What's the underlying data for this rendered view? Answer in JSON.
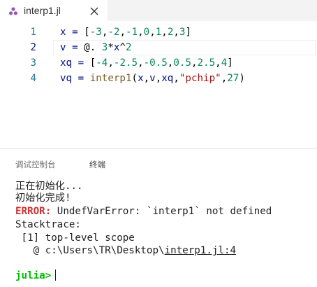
{
  "tab": {
    "label": "interp1.jl",
    "file_icon": "julia-file-icon",
    "close_icon": "close-icon",
    "icon_color": "#9558b2"
  },
  "editor": {
    "current_line": 2,
    "lines": [
      {
        "number": "1",
        "tokens": [
          {
            "t": "x = ",
            "c": "var"
          },
          {
            "t": "[",
            "c": "op"
          },
          {
            "t": "-3",
            "c": "num"
          },
          {
            "t": ",",
            "c": "op"
          },
          {
            "t": "-2",
            "c": "num"
          },
          {
            "t": ",",
            "c": "op"
          },
          {
            "t": "-1",
            "c": "num"
          },
          {
            "t": ",",
            "c": "op"
          },
          {
            "t": "0",
            "c": "num"
          },
          {
            "t": ",",
            "c": "op"
          },
          {
            "t": "1",
            "c": "num"
          },
          {
            "t": ",",
            "c": "op"
          },
          {
            "t": "2",
            "c": "num"
          },
          {
            "t": ",",
            "c": "op"
          },
          {
            "t": "3",
            "c": "num"
          },
          {
            "t": "]",
            "c": "op"
          }
        ]
      },
      {
        "number": "2",
        "tokens": [
          {
            "t": "v = ",
            "c": "var"
          },
          {
            "t": "@. ",
            "c": "op"
          },
          {
            "t": "3",
            "c": "num"
          },
          {
            "t": "*",
            "c": "op"
          },
          {
            "t": "x",
            "c": "var"
          },
          {
            "t": "^",
            "c": "op"
          },
          {
            "t": "2",
            "c": "num"
          }
        ]
      },
      {
        "number": "3",
        "tokens": [
          {
            "t": "xq = ",
            "c": "var"
          },
          {
            "t": "[",
            "c": "op"
          },
          {
            "t": "-4",
            "c": "num"
          },
          {
            "t": ",",
            "c": "op"
          },
          {
            "t": "-2.5",
            "c": "num"
          },
          {
            "t": ",",
            "c": "op"
          },
          {
            "t": "-0.5",
            "c": "num"
          },
          {
            "t": ",",
            "c": "op"
          },
          {
            "t": "0.5",
            "c": "num"
          },
          {
            "t": ",",
            "c": "op"
          },
          {
            "t": "2.5",
            "c": "num"
          },
          {
            "t": ",",
            "c": "op"
          },
          {
            "t": "4",
            "c": "num"
          },
          {
            "t": "]",
            "c": "op"
          }
        ]
      },
      {
        "number": "4",
        "tokens": [
          {
            "t": "vq = ",
            "c": "var"
          },
          {
            "t": "interp1",
            "c": "fn"
          },
          {
            "t": "(",
            "c": "op"
          },
          {
            "t": "x",
            "c": "var"
          },
          {
            "t": ",",
            "c": "op"
          },
          {
            "t": "v",
            "c": "var"
          },
          {
            "t": ",",
            "c": "op"
          },
          {
            "t": "xq",
            "c": "var"
          },
          {
            "t": ",",
            "c": "op"
          },
          {
            "t": "\"pchip\"",
            "c": "str"
          },
          {
            "t": ",",
            "c": "op"
          },
          {
            "t": "27",
            "c": "num"
          },
          {
            "t": ")",
            "c": "op"
          }
        ]
      }
    ]
  },
  "panel": {
    "tabs": [
      "调试控制台",
      "终端"
    ],
    "active_tab": "终端"
  },
  "terminal": {
    "line1": "正在初始化...",
    "line2": "初始化完成!",
    "error_label": "ERROR:",
    "error_message": " UndefVarError: `interp1` not defined",
    "stacktrace": "Stacktrace:",
    "frame": " [1] top-level scope",
    "at_prefix": "   @ c:\\Users\\TR\\Desktop\\",
    "at_link": "interp1.jl:4",
    "prompt": "julia>"
  },
  "colors": {
    "error": "#cd3131",
    "prompt": "#00bc00",
    "number": "#098658",
    "string": "#a31515",
    "function": "#795e26",
    "variable": "#001080",
    "line_number": "#237893"
  }
}
